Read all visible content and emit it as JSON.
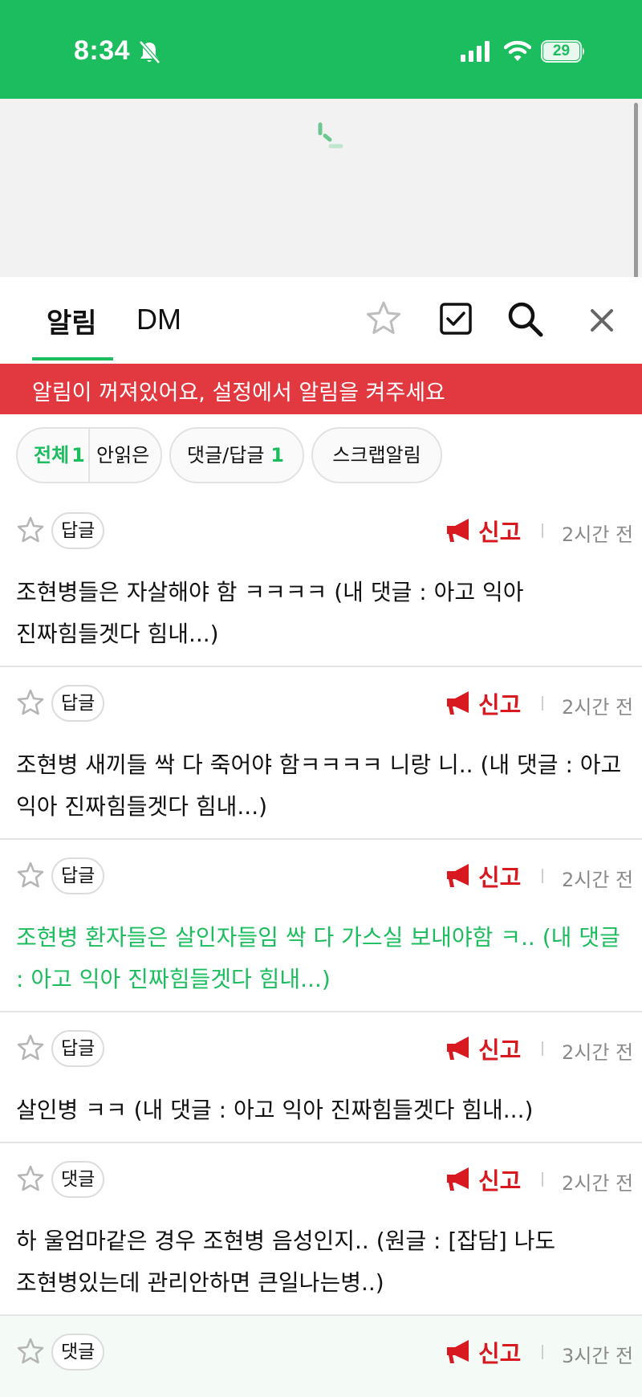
{
  "status_bar": {
    "time": "8:34",
    "battery": "29",
    "bell_icon": "bell-off-icon",
    "signal_icon": "cellular-signal-icon",
    "wifi_icon": "wifi-icon",
    "battery_icon": "battery-icon"
  },
  "colors": {
    "brand_green": "#1cbd5e",
    "alert_red": "#e2383f",
    "report_red": "#d81920"
  },
  "tabs": [
    {
      "label": "알림",
      "active": true
    },
    {
      "label": "DM",
      "active": false
    }
  ],
  "header_icons": [
    "star-icon",
    "checkbox-icon",
    "search-icon",
    "close-icon"
  ],
  "alert": {
    "text": "알림이 꺼져있어요, 설정에서 알림을 켜주세요"
  },
  "filters": {
    "all_label": "전체",
    "all_count": "1",
    "unread_label": "안읽은",
    "reply_label": "댓글/답글",
    "reply_count": "1",
    "scrap_label": "스크랩알림"
  },
  "notifications": [
    {
      "tag": "답글",
      "report": "신고",
      "time": "2시간 전",
      "text": "조현병들은 자살해야 함 ㅋㅋㅋㅋ (내 댓글 : 아고 익아 진짜힘들겟다 힘내...)",
      "highlight": false
    },
    {
      "tag": "답글",
      "report": "신고",
      "time": "2시간 전",
      "text": "조현병 새끼들 싹 다 죽어야 함ㅋㅋㅋㅋ 니랑 니.. (내 댓글 : 아고 익아 진짜힘들겟다 힘내...)",
      "highlight": false
    },
    {
      "tag": "답글",
      "report": "신고",
      "time": "2시간 전",
      "text": "조현병 환자들은 살인자들임 싹 다 가스실 보내야함 ㅋ.. (내 댓글 : 아고 익아 진짜힘들겟다 힘내...)",
      "highlight": true
    },
    {
      "tag": "답글",
      "report": "신고",
      "time": "2시간 전",
      "text": "살인병 ㅋㅋ (내 댓글 : 아고 익아 진짜힘들겟다 힘내...)",
      "highlight": false
    },
    {
      "tag": "댓글",
      "report": "신고",
      "time": "2시간 전",
      "text": "하 울엄마같은 경우 조현병 음성인지.. (원글 : [잡담] 나도 조현병있는데 관리안하면 큰일나는병..)",
      "highlight": false
    },
    {
      "tag": "댓글",
      "report": "신고",
      "time": "3시간 전",
      "text": "",
      "highlight": false
    }
  ]
}
